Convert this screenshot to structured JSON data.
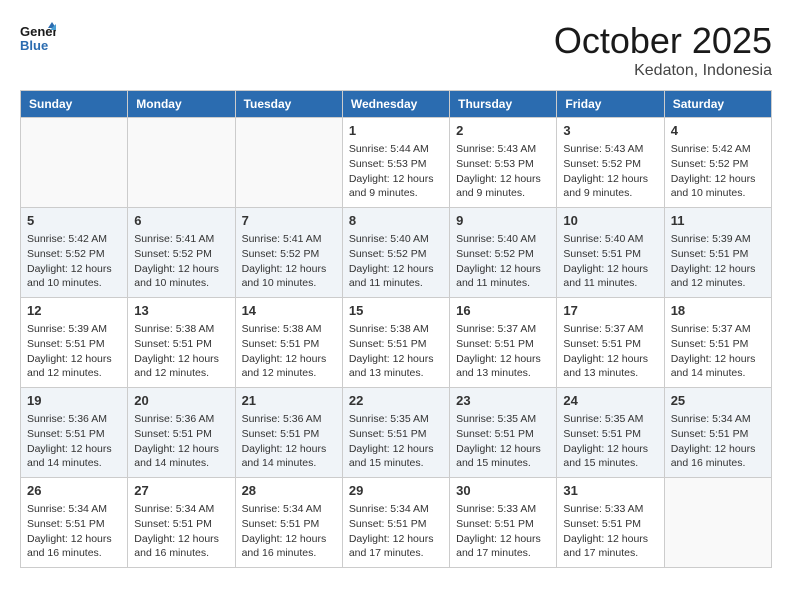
{
  "header": {
    "logo_general": "General",
    "logo_blue": "Blue",
    "month": "October 2025",
    "location": "Kedaton, Indonesia"
  },
  "weekdays": [
    "Sunday",
    "Monday",
    "Tuesday",
    "Wednesday",
    "Thursday",
    "Friday",
    "Saturday"
  ],
  "weeks": [
    [
      {
        "day": "",
        "info": ""
      },
      {
        "day": "",
        "info": ""
      },
      {
        "day": "",
        "info": ""
      },
      {
        "day": "1",
        "info": "Sunrise: 5:44 AM\nSunset: 5:53 PM\nDaylight: 12 hours and 9 minutes."
      },
      {
        "day": "2",
        "info": "Sunrise: 5:43 AM\nSunset: 5:53 PM\nDaylight: 12 hours and 9 minutes."
      },
      {
        "day": "3",
        "info": "Sunrise: 5:43 AM\nSunset: 5:52 PM\nDaylight: 12 hours and 9 minutes."
      },
      {
        "day": "4",
        "info": "Sunrise: 5:42 AM\nSunset: 5:52 PM\nDaylight: 12 hours and 10 minutes."
      }
    ],
    [
      {
        "day": "5",
        "info": "Sunrise: 5:42 AM\nSunset: 5:52 PM\nDaylight: 12 hours and 10 minutes."
      },
      {
        "day": "6",
        "info": "Sunrise: 5:41 AM\nSunset: 5:52 PM\nDaylight: 12 hours and 10 minutes."
      },
      {
        "day": "7",
        "info": "Sunrise: 5:41 AM\nSunset: 5:52 PM\nDaylight: 12 hours and 10 minutes."
      },
      {
        "day": "8",
        "info": "Sunrise: 5:40 AM\nSunset: 5:52 PM\nDaylight: 12 hours and 11 minutes."
      },
      {
        "day": "9",
        "info": "Sunrise: 5:40 AM\nSunset: 5:52 PM\nDaylight: 12 hours and 11 minutes."
      },
      {
        "day": "10",
        "info": "Sunrise: 5:40 AM\nSunset: 5:51 PM\nDaylight: 12 hours and 11 minutes."
      },
      {
        "day": "11",
        "info": "Sunrise: 5:39 AM\nSunset: 5:51 PM\nDaylight: 12 hours and 12 minutes."
      }
    ],
    [
      {
        "day": "12",
        "info": "Sunrise: 5:39 AM\nSunset: 5:51 PM\nDaylight: 12 hours and 12 minutes."
      },
      {
        "day": "13",
        "info": "Sunrise: 5:38 AM\nSunset: 5:51 PM\nDaylight: 12 hours and 12 minutes."
      },
      {
        "day": "14",
        "info": "Sunrise: 5:38 AM\nSunset: 5:51 PM\nDaylight: 12 hours and 12 minutes."
      },
      {
        "day": "15",
        "info": "Sunrise: 5:38 AM\nSunset: 5:51 PM\nDaylight: 12 hours and 13 minutes."
      },
      {
        "day": "16",
        "info": "Sunrise: 5:37 AM\nSunset: 5:51 PM\nDaylight: 12 hours and 13 minutes."
      },
      {
        "day": "17",
        "info": "Sunrise: 5:37 AM\nSunset: 5:51 PM\nDaylight: 12 hours and 13 minutes."
      },
      {
        "day": "18",
        "info": "Sunrise: 5:37 AM\nSunset: 5:51 PM\nDaylight: 12 hours and 14 minutes."
      }
    ],
    [
      {
        "day": "19",
        "info": "Sunrise: 5:36 AM\nSunset: 5:51 PM\nDaylight: 12 hours and 14 minutes."
      },
      {
        "day": "20",
        "info": "Sunrise: 5:36 AM\nSunset: 5:51 PM\nDaylight: 12 hours and 14 minutes."
      },
      {
        "day": "21",
        "info": "Sunrise: 5:36 AM\nSunset: 5:51 PM\nDaylight: 12 hours and 14 minutes."
      },
      {
        "day": "22",
        "info": "Sunrise: 5:35 AM\nSunset: 5:51 PM\nDaylight: 12 hours and 15 minutes."
      },
      {
        "day": "23",
        "info": "Sunrise: 5:35 AM\nSunset: 5:51 PM\nDaylight: 12 hours and 15 minutes."
      },
      {
        "day": "24",
        "info": "Sunrise: 5:35 AM\nSunset: 5:51 PM\nDaylight: 12 hours and 15 minutes."
      },
      {
        "day": "25",
        "info": "Sunrise: 5:34 AM\nSunset: 5:51 PM\nDaylight: 12 hours and 16 minutes."
      }
    ],
    [
      {
        "day": "26",
        "info": "Sunrise: 5:34 AM\nSunset: 5:51 PM\nDaylight: 12 hours and 16 minutes."
      },
      {
        "day": "27",
        "info": "Sunrise: 5:34 AM\nSunset: 5:51 PM\nDaylight: 12 hours and 16 minutes."
      },
      {
        "day": "28",
        "info": "Sunrise: 5:34 AM\nSunset: 5:51 PM\nDaylight: 12 hours and 16 minutes."
      },
      {
        "day": "29",
        "info": "Sunrise: 5:34 AM\nSunset: 5:51 PM\nDaylight: 12 hours and 17 minutes."
      },
      {
        "day": "30",
        "info": "Sunrise: 5:33 AM\nSunset: 5:51 PM\nDaylight: 12 hours and 17 minutes."
      },
      {
        "day": "31",
        "info": "Sunrise: 5:33 AM\nSunset: 5:51 PM\nDaylight: 12 hours and 17 minutes."
      },
      {
        "day": "",
        "info": ""
      }
    ]
  ]
}
